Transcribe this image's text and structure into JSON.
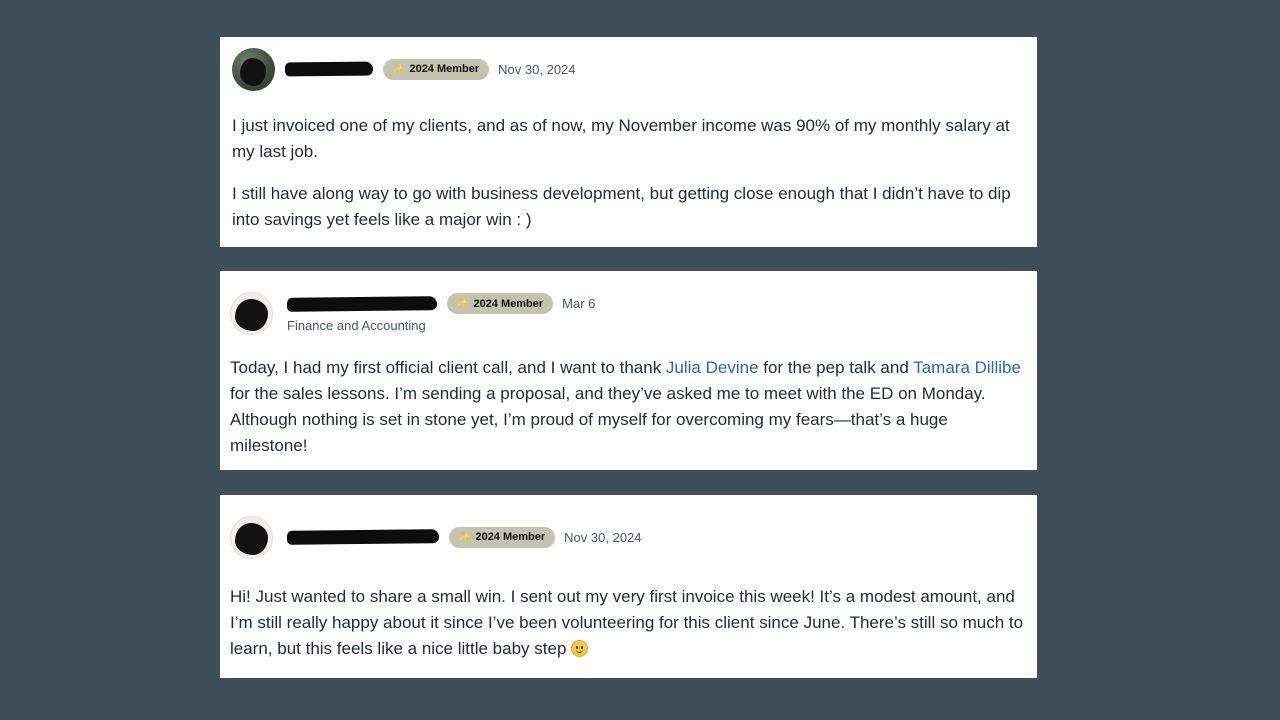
{
  "posts": [
    {
      "badge_icon": "✨",
      "badge_label": "2024 Member",
      "date": "Nov 30, 2024",
      "paragraphs": [
        "I just invoiced one of my clients, and as of now, my November income was 90% of my monthly salary at my last job.",
        "I still have  along way to go with business development, but getting close enough that I didn’t have to dip into savings yet feels like a major win : )"
      ]
    },
    {
      "badge_icon": "✨",
      "badge_label": "2024 Member",
      "date": "Mar 6",
      "subtitle": "Finance and Accounting",
      "text_1": "Today, I had my first official client call, and I want to thank ",
      "mention_1": "Julia Devine",
      "text_2": " for the pep talk and ",
      "mention_2": "Tamara Dillibe",
      "text_3": " for the sales lessons. I’m sending a proposal, and they’ve asked me to meet with the ED on Monday. Although nothing is set in stone yet, I’m proud of myself for overcoming my fears—that’s a huge milestone!"
    },
    {
      "badge_icon": "✨",
      "badge_label": "2024 Member",
      "date": "Nov 30, 2024",
      "text": "Hi! Just wanted to share a small win. I sent out my very first invoice this week! It’s a modest amount, and I’m still really happy about it since I’ve been volunteering for this client since June. There’s still so much to learn, but this feels like a nice little baby step "
    }
  ],
  "colors": {
    "background": "#3f4f58",
    "card": "#ffffff",
    "badge": "#c2c4ad",
    "mention": "#2563c9"
  }
}
